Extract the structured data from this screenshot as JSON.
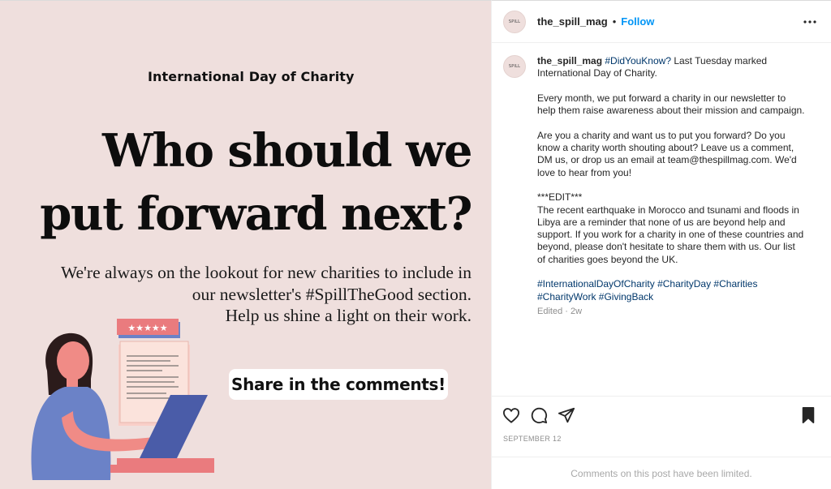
{
  "image": {
    "kicker": "International Day of Charity",
    "headline_line1": "Who should we",
    "headline_line2": "put forward next?",
    "body_line1": "We're always on the lookout for new charities to include in",
    "body_line2": "our newsletter's #SpillTheGood section.",
    "body_line3": "Help us shine a light on their work.",
    "cta": "Share in the comments!",
    "rating_stars": "★★★★★",
    "colors": {
      "background": "#efdfdd",
      "accent_pink": "#ea7b7e",
      "accent_blue": "#6b82c7"
    }
  },
  "header": {
    "avatar_text": "SPILL",
    "username": "the_spill_mag",
    "separator": "•",
    "follow_label": "Follow",
    "more_icon": "more-horizontal-icon"
  },
  "caption": {
    "avatar_text": "SPILL",
    "username": "the_spill_mag",
    "hashtag_lead": "#DidYouKnow?",
    "line1_rest": " Last Tuesday marked International Day of Charity.",
    "para2": "Every month, we put forward a charity in our newsletter to help them raise awareness about their mission and campaign.",
    "para3": "Are you a charity and want us to put you forward? Do you know a charity worth shouting about? Leave us a comment, DM us, or drop us an email at team@thespillmag.com. We'd love to hear from you!",
    "edit_marker": "***EDIT***",
    "para4": "The recent earthquake in Morocco and tsunami and floods in Libya are a reminder that none of us are beyond help and support. If you work for a charity in one of these countries and beyond, please don't hesitate to share them with us. Our list of charities goes beyond the UK.",
    "hashtags": "#InternationalDayOfCharity #CharityDay #Charities #CharityWork #GivingBack",
    "meta": "Edited · 2w"
  },
  "actions": {
    "like_icon": "heart-icon",
    "comment_icon": "comment-icon",
    "share_icon": "send-icon",
    "save_icon": "bookmark-icon"
  },
  "post_date": "SEPTEMBER 12",
  "comments_notice": "Comments on this post have been limited."
}
